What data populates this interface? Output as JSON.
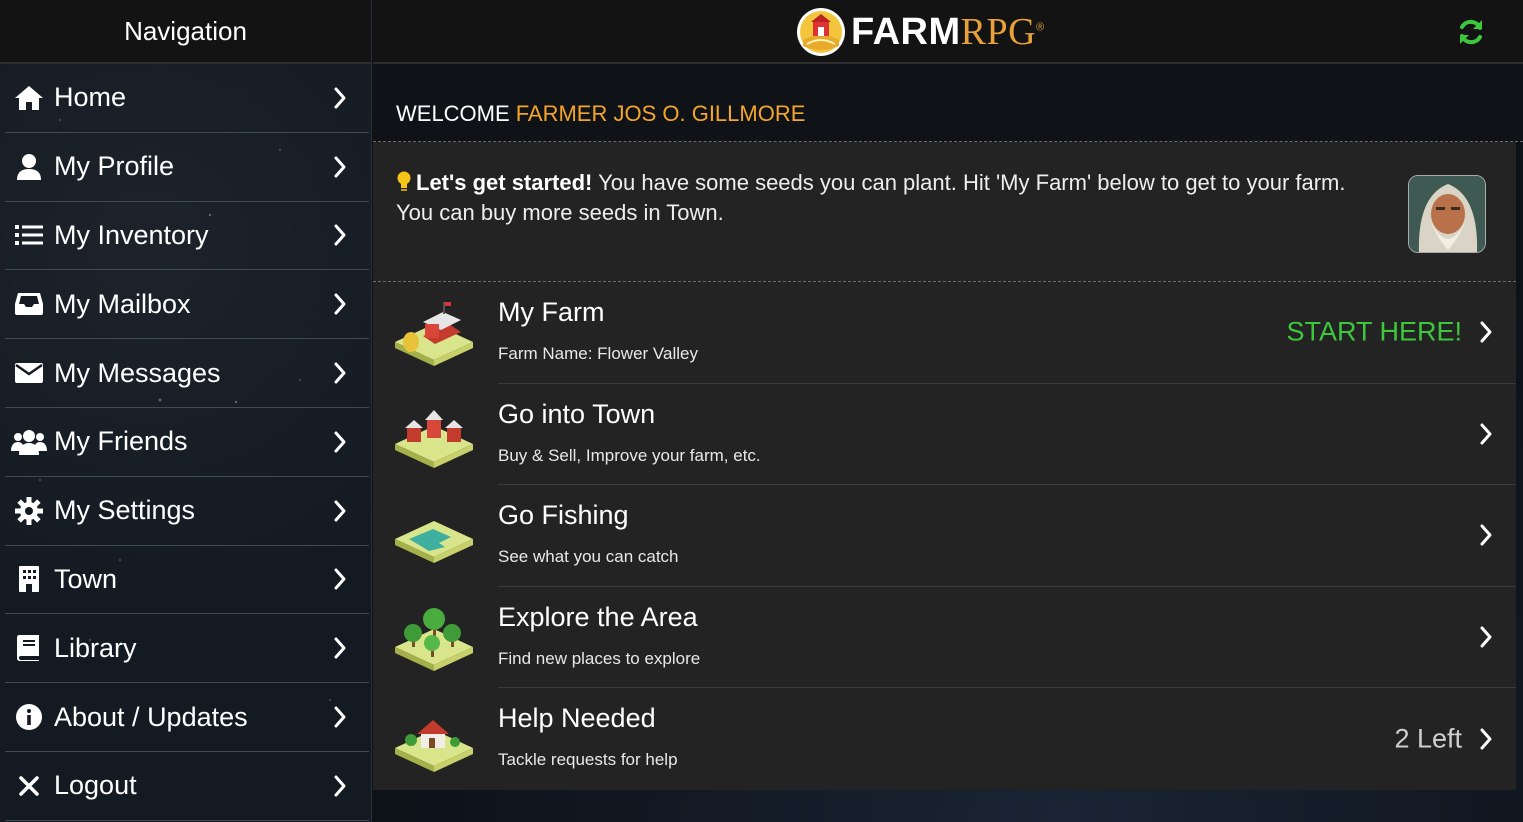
{
  "sidebar": {
    "title": "Navigation",
    "items": [
      {
        "label": "Home",
        "icon": "home-icon"
      },
      {
        "label": "My Profile",
        "icon": "user-icon"
      },
      {
        "label": "My Inventory",
        "icon": "list-icon"
      },
      {
        "label": "My Mailbox",
        "icon": "inbox-icon"
      },
      {
        "label": "My Messages",
        "icon": "envelope-icon"
      },
      {
        "label": "My Friends",
        "icon": "users-icon"
      },
      {
        "label": "My Settings",
        "icon": "gear-icon"
      },
      {
        "label": "Town",
        "icon": "building-icon"
      },
      {
        "label": "Library",
        "icon": "book-icon"
      },
      {
        "label": "About / Updates",
        "icon": "info-icon"
      },
      {
        "label": "Logout",
        "icon": "close-icon"
      }
    ]
  },
  "header": {
    "logo_farm": "FARM",
    "logo_rpg": "RPG",
    "logo_reg": "®",
    "refresh_icon": "refresh-icon"
  },
  "welcome": {
    "prefix": "WELCOME",
    "name": "FARMER JOS O. GILLMORE"
  },
  "notice": {
    "strong": "Let's get started!",
    "text": " You have some seeds you can plant. Hit 'My Farm' below to get to your farm. You can buy more seeds in Town."
  },
  "menu": [
    {
      "title": "My Farm",
      "subtitle": "Farm Name: Flower Valley",
      "after": "START HERE!",
      "after_color": "#3cc73c"
    },
    {
      "title": "Go into Town",
      "subtitle": "Buy & Sell, Improve your farm, etc.",
      "after": ""
    },
    {
      "title": "Go Fishing",
      "subtitle": "See what you can catch",
      "after": ""
    },
    {
      "title": "Explore the Area",
      "subtitle": "Find new places to explore",
      "after": ""
    },
    {
      "title": "Help Needed",
      "subtitle": "Tackle requests for help",
      "after": "2 Left",
      "after_color": "#cfcfcf"
    }
  ],
  "colors": {
    "accent_orange": "#f4a52a",
    "accent_green": "#3cc73c",
    "panel_bg": "#232323"
  }
}
